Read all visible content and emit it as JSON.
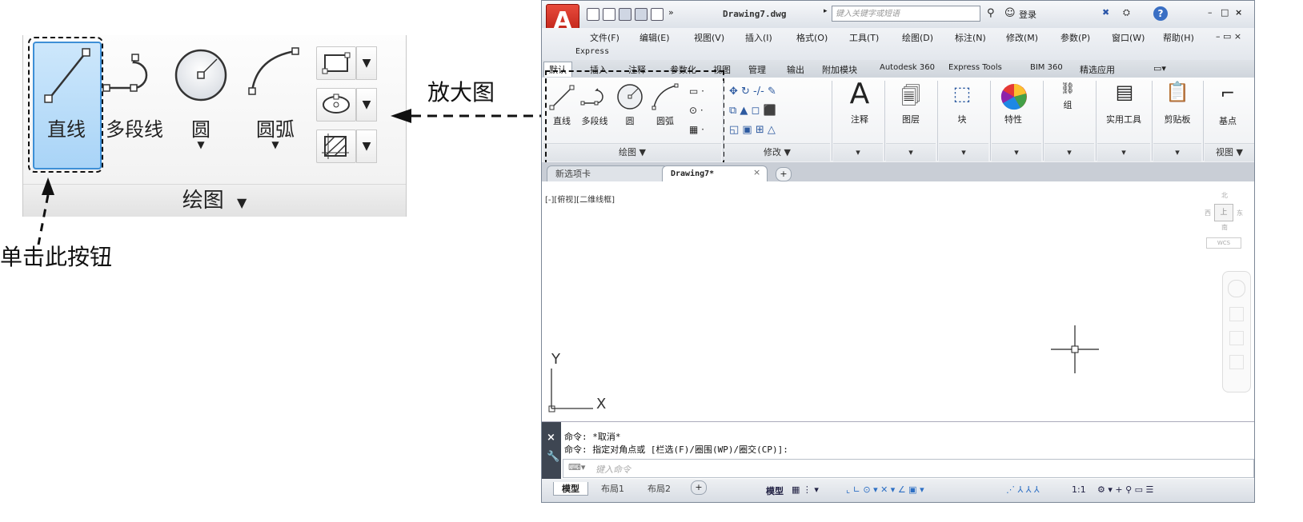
{
  "zoom_panel": {
    "tools": {
      "line": "直线",
      "polyline": "多段线",
      "circle": "圆",
      "arc": "圆弧"
    },
    "panel_title": "绘图",
    "dropdown_glyph": "▼"
  },
  "annotations": {
    "zoom_label": "放大图",
    "click_label": "单击此按钮"
  },
  "app": {
    "logo_letter": "A",
    "doc_title": "Drawing7.dwg",
    "search_placeholder": "键入关键字或短语",
    "sign_in": "登录",
    "help": "?"
  },
  "menu": {
    "items": [
      "文件(F)",
      "编辑(E)",
      "视图(V)",
      "插入(I)",
      "格式(O)",
      "工具(T)",
      "绘图(D)",
      "标注(N)",
      "修改(M)",
      "参数(P)",
      "窗口(W)",
      "帮助(H)"
    ],
    "express": "Express"
  },
  "ribbon_tabs": [
    "默认",
    "插入",
    "注释",
    "参数化",
    "视图",
    "管理",
    "输出",
    "附加模块",
    "Autodesk 360",
    "Express Tools",
    "BIM 360",
    "精选应用"
  ],
  "ribbon": {
    "draw": {
      "labels": [
        "直线",
        "多段线",
        "圆",
        "圆弧"
      ],
      "footer": "绘图 ▼"
    },
    "modify": {
      "footer": "修改 ▼"
    },
    "panels": [
      "注释",
      "图层",
      "块",
      "特性",
      "组",
      "实用工具",
      "剪贴板",
      "基点"
    ],
    "view_footer": "视图 ▼"
  },
  "doc_tabs": {
    "start": "新选项卡",
    "current": "Drawing7*",
    "close": "×",
    "add": "+"
  },
  "viewport": {
    "label": "[-][俯视][二维线框]",
    "y_axis": "Y",
    "x_axis": "X",
    "viewcube": {
      "n": "北",
      "s": "南",
      "w": "西",
      "e": "东",
      "top": "上",
      "wcs": "WCS"
    }
  },
  "command": {
    "line1": "命令: *取消*",
    "line2": "命令: 指定对角点或 [栏选(F)/圈围(WP)/圈交(CP)]:",
    "placeholder": "键入命令"
  },
  "status": {
    "layout_tabs": [
      "模型",
      "布局1",
      "布局2"
    ],
    "model": "模型",
    "scale": "1:1"
  }
}
